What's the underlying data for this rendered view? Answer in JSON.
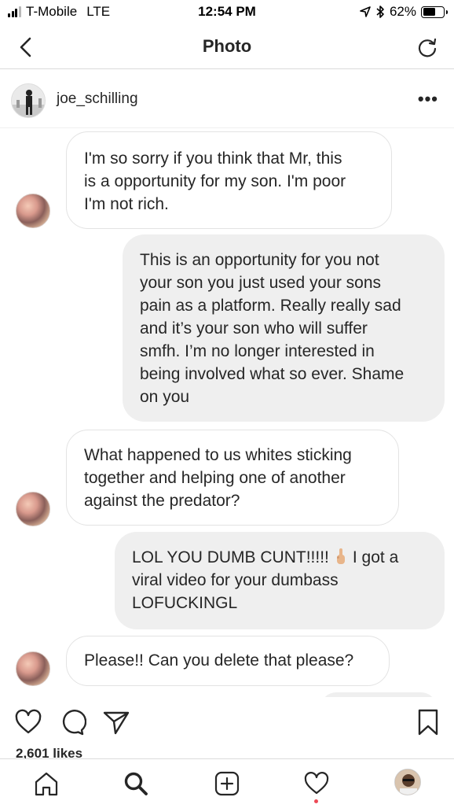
{
  "status_bar": {
    "carrier": "T-Mobile",
    "network": "LTE",
    "time": "12:54 PM",
    "battery_percent": "62%",
    "battery_level": 0.62,
    "signal_bars": 3,
    "icons": [
      "location-icon",
      "bluetooth-icon",
      "battery-icon"
    ]
  },
  "nav": {
    "title": "Photo",
    "back_icon": "chevron-left-icon",
    "refresh_icon": "refresh-icon"
  },
  "post": {
    "username": "joe_schilling",
    "more_label": "•••"
  },
  "messages": [
    {
      "direction": "received",
      "text": "I'm so sorry if you think that Mr, this\nis a opportunity for my son. I'm poor\nI'm not rich."
    },
    {
      "direction": "sent",
      "text": "This is an opportunity for you not\nyour son you just used your sons\npain as a platform. Really really sad\nand it’s your son who will suffer\nsmfh.  I’m no longer interested in\nbeing involved what so ever. Shame\non you"
    },
    {
      "direction": "received",
      "text": "What happened to us whites sticking\ntogether and helping one of another\nagainst the predator?"
    },
    {
      "direction": "sent",
      "text_before_emoji": "LOL YOU DUMB CUNT!!!!!",
      "emoji": "middle-finger-emoji",
      "text_after_emoji": "I got a",
      "text_rest": "viral video for your dumbass\nLOFUCKINGL"
    },
    {
      "direction": "received",
      "text": "Please!! Can you delete that please?"
    }
  ],
  "actions": {
    "icons": [
      "heart-icon",
      "comment-icon",
      "share-icon",
      "bookmark-icon"
    ],
    "likes": "2,601 likes"
  },
  "tab_bar": {
    "icons": [
      "home-icon",
      "search-icon",
      "add-post-icon",
      "activity-icon",
      "profile-avatar"
    ],
    "activity_indicator_color": "#ed4956"
  }
}
